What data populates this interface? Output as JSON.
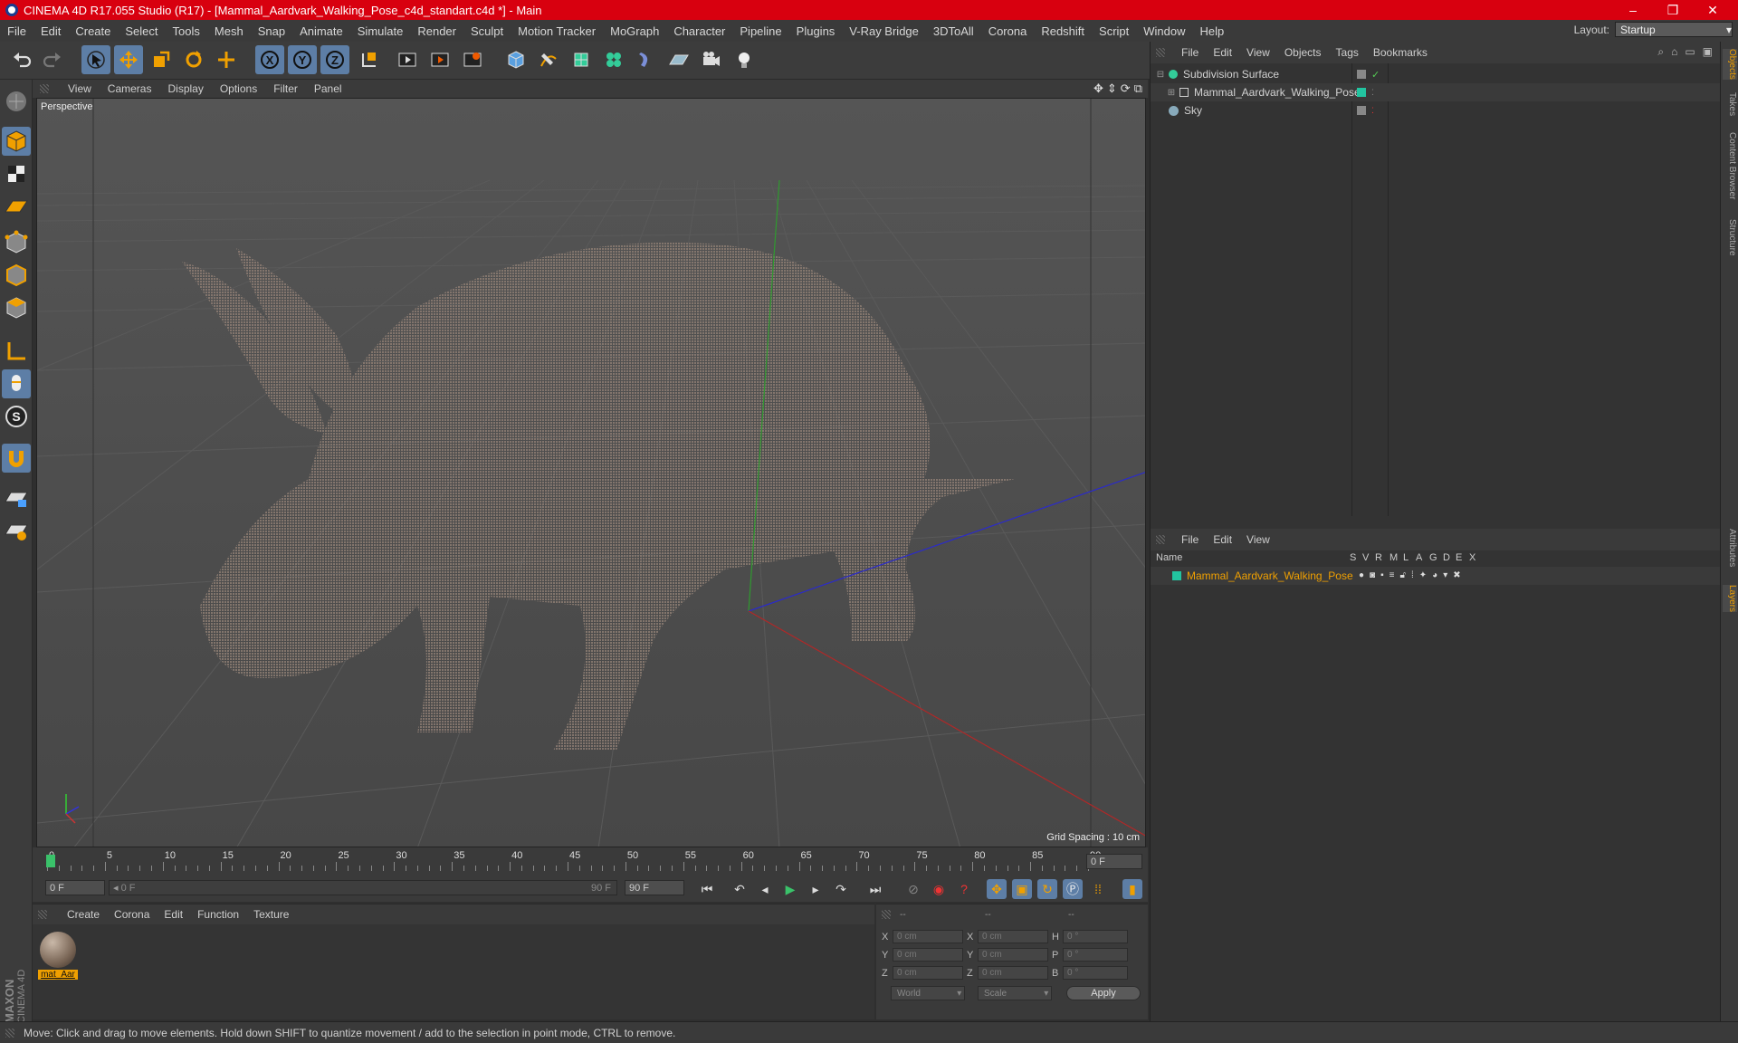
{
  "window": {
    "title": "CINEMA 4D R17.055 Studio (R17) - [Mammal_Aardvark_Walking_Pose_c4d_standart.c4d *] - Main",
    "minimize": "–",
    "maximize": "❐",
    "close": "✕"
  },
  "menubar": {
    "items": [
      "File",
      "Edit",
      "Create",
      "Select",
      "Tools",
      "Mesh",
      "Snap",
      "Animate",
      "Simulate",
      "Render",
      "Sculpt",
      "Motion Tracker",
      "MoGraph",
      "Character",
      "Pipeline",
      "Plugins",
      "V-Ray Bridge",
      "3DToAll",
      "Corona",
      "Redshift",
      "Script",
      "Window",
      "Help"
    ],
    "layout_label": "Layout:",
    "layout_value": "Startup"
  },
  "viewport": {
    "menu": [
      "View",
      "Cameras",
      "Display",
      "Options",
      "Filter",
      "Panel"
    ],
    "camera_label": "Perspective",
    "grid_spacing": "Grid Spacing : 10 cm"
  },
  "timeline": {
    "ticks": [
      "0",
      "5",
      "10",
      "15",
      "20",
      "25",
      "30",
      "35",
      "40",
      "45",
      "50",
      "55",
      "60",
      "65",
      "70",
      "75",
      "80",
      "85",
      "90"
    ],
    "current_frame": "0 F",
    "start_frame": "0 F",
    "range_start": "0 F",
    "range_end": "90 F",
    "end_frame": "90 F"
  },
  "material_manager": {
    "menu": [
      "Create",
      "Corona",
      "Edit",
      "Function",
      "Texture"
    ],
    "materials": [
      {
        "label": "mat_Aar"
      }
    ]
  },
  "coordinates": {
    "headers": [
      "--",
      "--",
      "--"
    ],
    "rows": [
      {
        "a": "X",
        "v1": "0 cm",
        "b": "X",
        "v2": "0 cm",
        "c": "H",
        "v3": "0 °"
      },
      {
        "a": "Y",
        "v1": "0 cm",
        "b": "Y",
        "v2": "0 cm",
        "c": "P",
        "v3": "0 °"
      },
      {
        "a": "Z",
        "v1": "0 cm",
        "b": "Z",
        "v2": "0 cm",
        "c": "B",
        "v3": "0 °"
      }
    ],
    "mode1": "World",
    "mode2": "Scale",
    "apply": "Apply"
  },
  "object_manager": {
    "menu": [
      "File",
      "Edit",
      "View",
      "Objects",
      "Tags",
      "Bookmarks"
    ],
    "objects": [
      {
        "name": "Subdivision Surface"
      },
      {
        "name": "Mammal_Aardvark_Walking_Pose"
      },
      {
        "name": "Sky"
      }
    ]
  },
  "layer_manager": {
    "menu": [
      "File",
      "Edit",
      "View"
    ],
    "columns": [
      "Name",
      "S",
      "V",
      "R",
      "M",
      "L",
      "A",
      "G",
      "D",
      "E",
      "X"
    ],
    "layers": [
      {
        "name": "Mammal_Aardvark_Walking_Pose"
      }
    ]
  },
  "right_tabs": [
    "Objects",
    "Takes",
    "Content Browser",
    "Structure",
    "Attributes",
    "Layers"
  ],
  "branding": {
    "line1": "MAXON",
    "line2": "CINEMA 4D"
  },
  "status": "Move: Click and drag to move elements. Hold down SHIFT to quantize movement / add to the selection in point mode, CTRL to remove.",
  "colors": {
    "titlebar": "#d8000f",
    "accent": "#5d7ea6",
    "orange": "#f0a000",
    "layer_green": "#22c4a0"
  }
}
